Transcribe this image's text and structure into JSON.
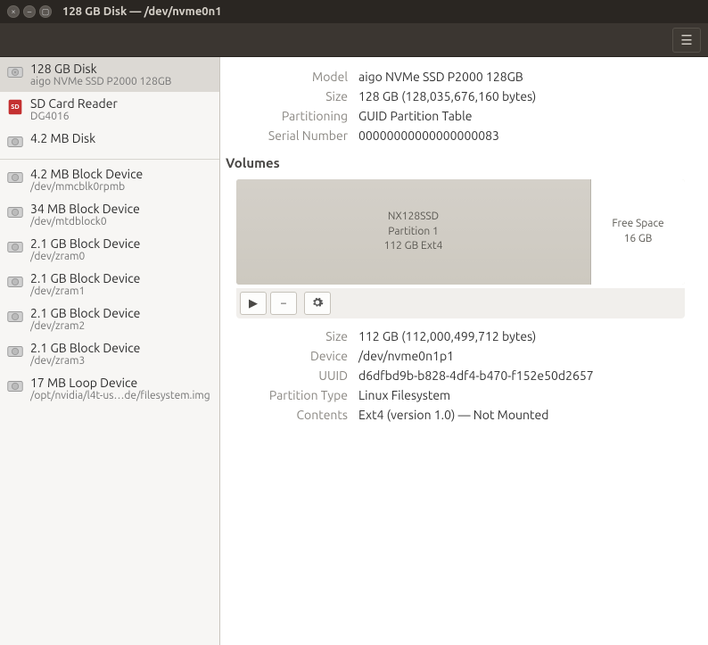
{
  "window": {
    "title": "128 GB Disk — /dev/nvme0n1"
  },
  "sidebar": {
    "items": [
      {
        "title": "128 GB Disk",
        "sub": "aigo NVMe SSD P2000 128GB",
        "icon": "disk",
        "selected": true
      },
      {
        "title": "SD Card Reader",
        "sub": "DG4016",
        "icon": "sd"
      },
      {
        "title": "4.2 MB Disk",
        "sub": "",
        "icon": "disk"
      },
      {
        "sep": true
      },
      {
        "title": "4.2 MB Block Device",
        "sub": "/dev/mmcblk0rpmb",
        "icon": "disk"
      },
      {
        "title": "34 MB Block Device",
        "sub": "/dev/mtdblock0",
        "icon": "disk"
      },
      {
        "title": "2.1 GB Block Device",
        "sub": "/dev/zram0",
        "icon": "disk"
      },
      {
        "title": "2.1 GB Block Device",
        "sub": "/dev/zram1",
        "icon": "disk"
      },
      {
        "title": "2.1 GB Block Device",
        "sub": "/dev/zram2",
        "icon": "disk"
      },
      {
        "title": "2.1 GB Block Device",
        "sub": "/dev/zram3",
        "icon": "disk"
      },
      {
        "title": "17 MB Loop Device",
        "sub": "/opt/nvidia/l4t-us…de/filesystem.img",
        "icon": "disk"
      }
    ]
  },
  "disk": {
    "labels": {
      "model": "Model",
      "size": "Size",
      "partitioning": "Partitioning",
      "serial": "Serial Number"
    },
    "model": "aigo NVMe SSD P2000 128GB",
    "size": "128 GB (128,035,676,160 bytes)",
    "partitioning": "GUID Partition Table",
    "serial": "00000000000000000083"
  },
  "volumes": {
    "heading": "Volumes",
    "partitions": [
      {
        "name": "NX128SSD",
        "label": "Partition 1",
        "fs": "112 GB Ext4",
        "kind": "used"
      },
      {
        "name": "Free Space",
        "size": "16 GB",
        "kind": "free"
      }
    ]
  },
  "partition": {
    "labels": {
      "size": "Size",
      "device": "Device",
      "uuid": "UUID",
      "ptype": "Partition Type",
      "contents": "Contents"
    },
    "size": "112 GB (112,000,499,712 bytes)",
    "device": "/dev/nvme0n1p1",
    "uuid": "d6dfbd9b-b828-4df4-b470-f152e50d2657",
    "ptype": "Linux Filesystem",
    "contents": "Ext4 (version 1.0) — Not Mounted"
  }
}
